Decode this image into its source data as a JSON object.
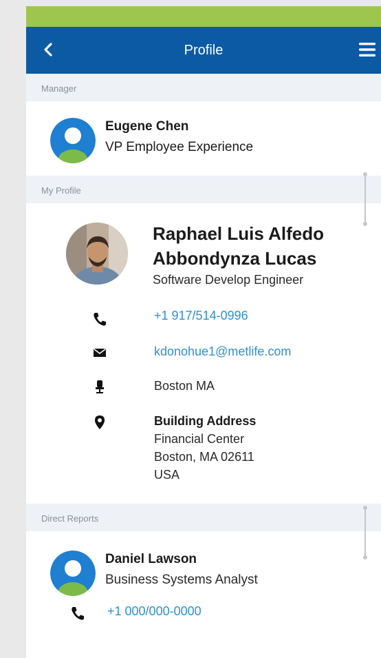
{
  "header": {
    "title": "Profile"
  },
  "manager": {
    "section_label": "Manager",
    "name": "Eugene Chen",
    "title": "VP Employee Experience"
  },
  "my_profile": {
    "section_label": "My Profile",
    "name_line1": "Raphael Luis Alfedo",
    "name_line2": "Abbondynza Lucas",
    "title": "Software Develop Engineer",
    "phone": "+1 917/514-0996",
    "email": "kdonohue1@metlife.com",
    "office": "Boston MA",
    "address_label": "Building Address",
    "address_line1": "Financial Center",
    "address_line2": "Boston, MA 02611",
    "address_line3": "USA"
  },
  "direct_reports": {
    "section_label": "Direct Reports",
    "items": [
      {
        "name": "Daniel Lawson",
        "title": "Business Systems Analyst",
        "phone": "+1 000/000-0000"
      }
    ]
  },
  "colors": {
    "status_bar": "#9ec64f",
    "header": "#0c5aa4",
    "avatar_blue": "#1f7fd0",
    "avatar_green": "#7dbb48",
    "link": "#2f8fd6"
  },
  "icons": [
    "back-arrow-icon",
    "hamburger-menu-icon",
    "avatar-icon",
    "phone-icon",
    "mail-icon",
    "desk-chair-icon",
    "location-pin-icon"
  ]
}
